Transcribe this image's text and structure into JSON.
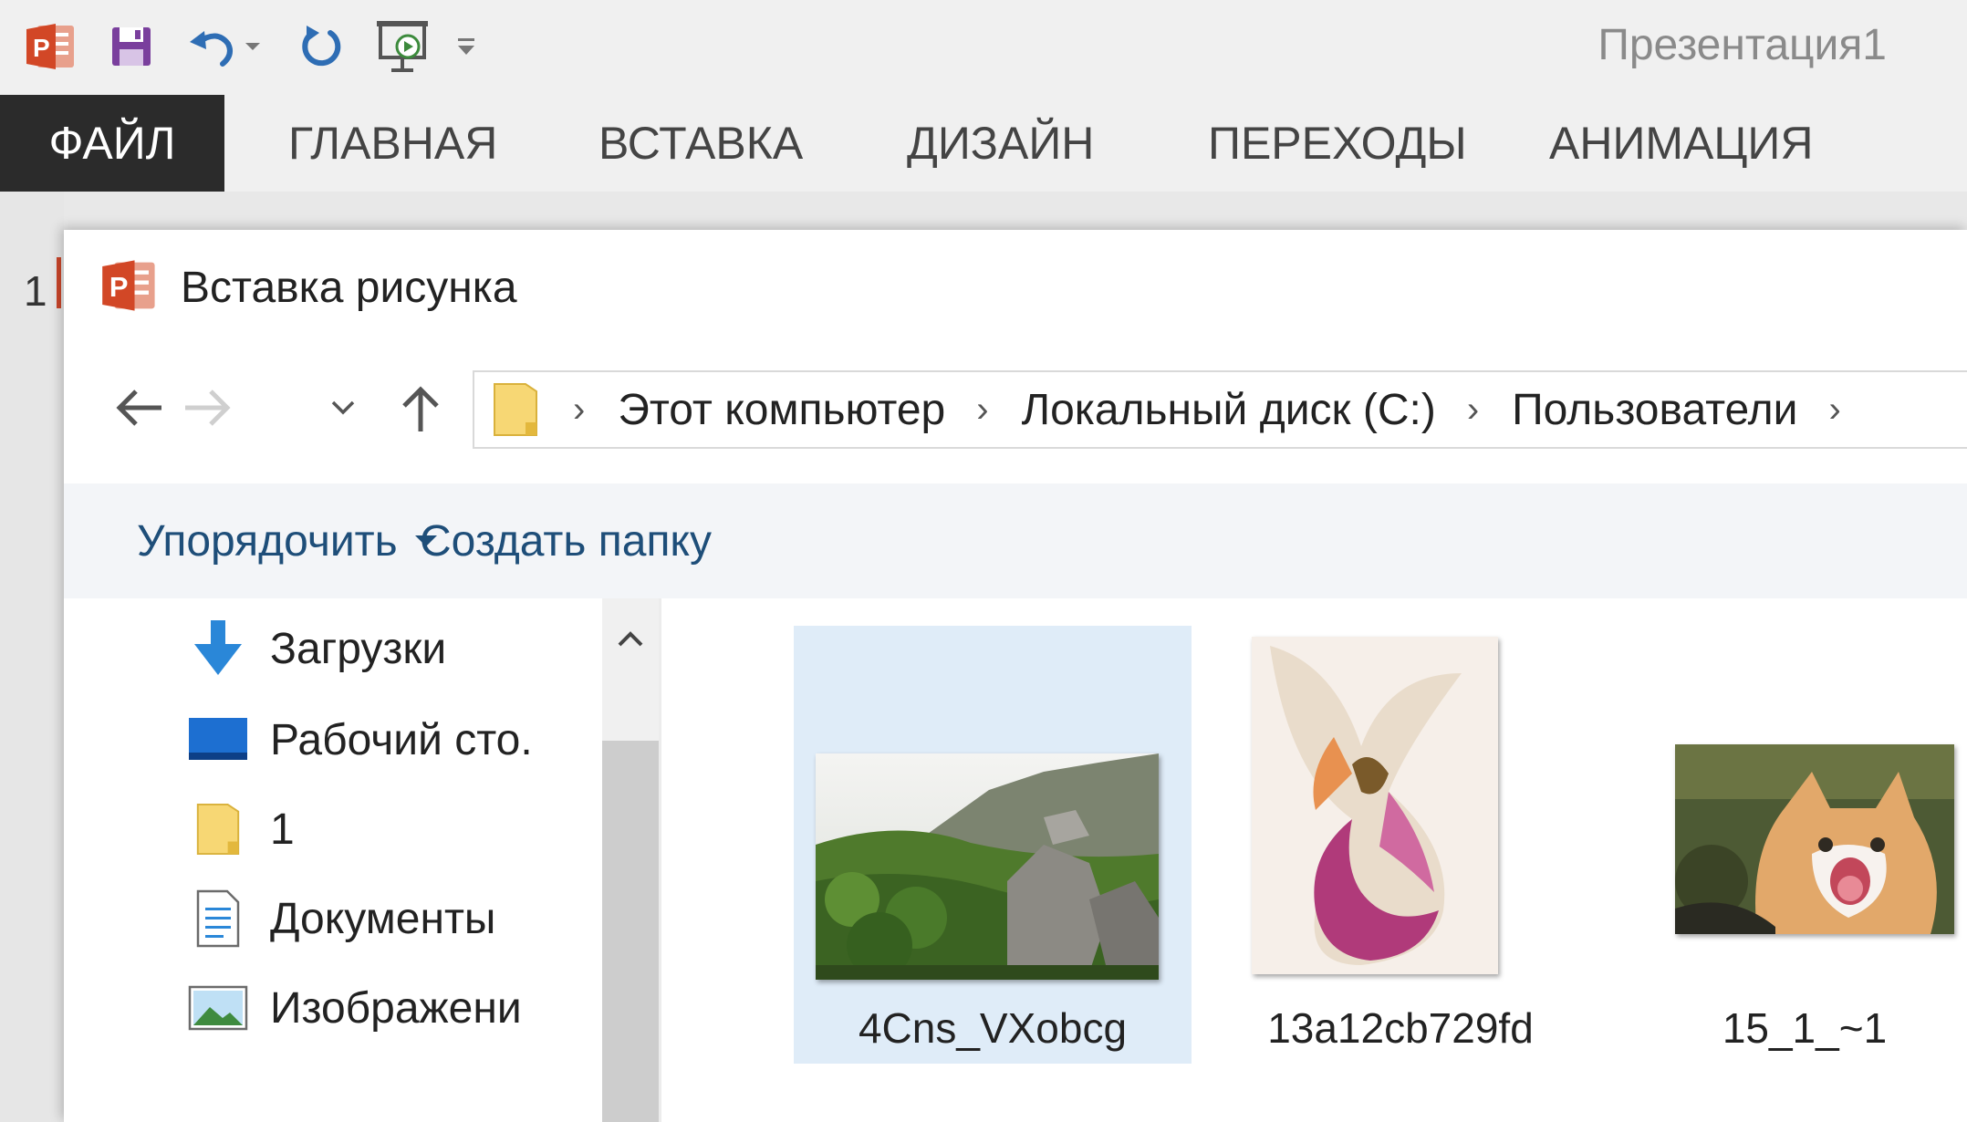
{
  "window": {
    "title": "Презентация1"
  },
  "ribbon": {
    "tabs": [
      {
        "label": "ФАЙЛ"
      },
      {
        "label": "ГЛАВНАЯ"
      },
      {
        "label": "ВСТАВКА"
      },
      {
        "label": "ДИЗАЙН"
      },
      {
        "label": "ПЕРЕХОДЫ"
      },
      {
        "label": "АНИМАЦИЯ"
      }
    ]
  },
  "slides": {
    "current_number": "1"
  },
  "dialog": {
    "title": "Вставка рисунка",
    "address": {
      "crumbs": [
        {
          "label": "Этот компьютер"
        },
        {
          "label": "Локальный диск (C:)"
        },
        {
          "label": "Пользователи"
        }
      ]
    },
    "toolbar": {
      "organize_label": "Упорядочить",
      "new_folder_label": "Создать папку"
    },
    "nav_items": [
      {
        "label": "Загрузки",
        "icon": "download-icon"
      },
      {
        "label": "Рабочий сто.",
        "icon": "desktop-icon"
      },
      {
        "label": "1",
        "icon": "folder-icon"
      },
      {
        "label": "Документы",
        "icon": "document-icon"
      },
      {
        "label": "Изображени",
        "icon": "image-icon"
      }
    ],
    "files": [
      {
        "name": "4Cns_VXobcg",
        "selected": true
      },
      {
        "name": "13a12cb729fd",
        "selected": false
      },
      {
        "name": "15_1_~1",
        "selected": false
      }
    ]
  },
  "colors": {
    "accent": "#d24726",
    "file_tab_bg": "#2b2b2b",
    "selection": "#dfecf8",
    "link_text": "#1e4e79"
  }
}
